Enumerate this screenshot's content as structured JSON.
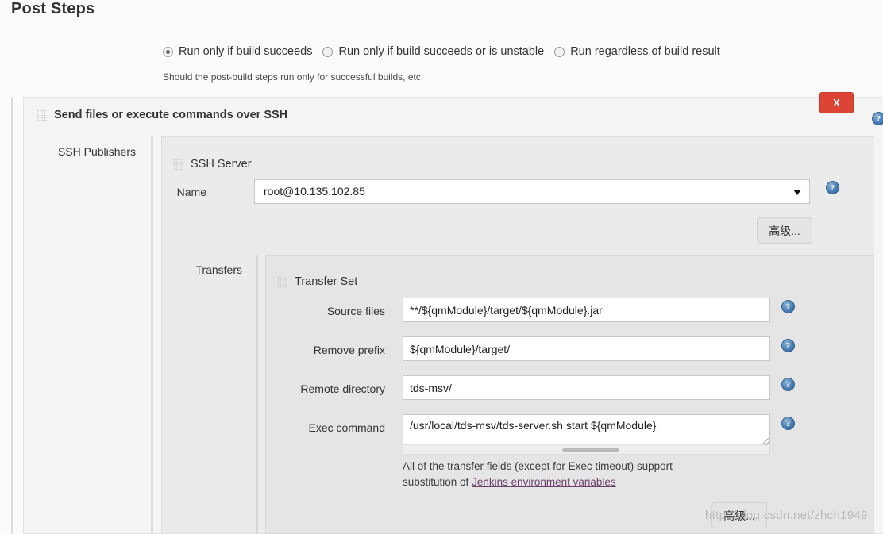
{
  "page": {
    "title": "Post Steps"
  },
  "trigger": {
    "options": [
      {
        "label": "Run only if build succeeds",
        "selected": true
      },
      {
        "label": "Run only if build succeeds or is unstable",
        "selected": false
      },
      {
        "label": "Run regardless of build result",
        "selected": false
      }
    ],
    "help_text": "Should the post-build steps run only for successful builds, etc."
  },
  "block": {
    "title": "Send files or execute commands over SSH",
    "close_label": "X",
    "close_color": "#dc4436"
  },
  "publishers": {
    "label": "SSH Publishers"
  },
  "ssh_server": {
    "title": "SSH Server",
    "name_label": "Name",
    "name_value": "root@10.135.102.85",
    "advanced_label": "高级..."
  },
  "transfers": {
    "label": "Transfers",
    "set_title": "Transfer Set",
    "fields": [
      {
        "label": "Source files",
        "value": "**/${qmModule}/target/${qmModule}.jar"
      },
      {
        "label": "Remove prefix",
        "value": "${qmModule}/target/"
      },
      {
        "label": "Remote directory",
        "value": "tds-msv/"
      },
      {
        "label": "Exec command",
        "value": "/usr/local/tds-msv/tds-server.sh start ${qmModule}"
      }
    ],
    "note_line1": "All of the transfer fields (except for Exec timeout) support",
    "note_line2_prefix": "substitution of ",
    "note_link": "Jenkins environment variables",
    "advanced_label": "高级..."
  },
  "icons": {
    "help": "?",
    "help_color": "#4a7fb5"
  },
  "watermark": "http://blog.csdn.net/zhch1949"
}
